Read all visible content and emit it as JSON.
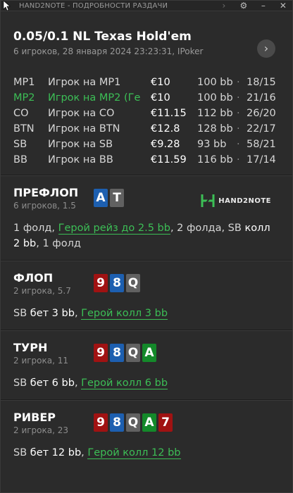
{
  "window": {
    "title": "HAND2NOTE - ПОДРОБНОСТИ РАЗДАЧИ",
    "icons": [
      "chevron-right-icon",
      "gear-icon",
      "minimize-icon",
      "close-icon"
    ]
  },
  "header": {
    "title": "0.05/0.1 NL Texas Hold'em",
    "subtitle": "6 игроков, 28 января 2024 23:23:31, IPoker",
    "nav_symbol": "›"
  },
  "players": [
    {
      "pos": "MP1",
      "name": "Игрок на MP1",
      "stack": "€10",
      "bb": "100 bb",
      "stats": "18/15",
      "hero": false
    },
    {
      "pos": "MP2",
      "name": "Игрок на MP2 (Ге",
      "stack": "€10",
      "bb": "100 bb",
      "stats": "21/16",
      "hero": true
    },
    {
      "pos": "CO",
      "name": "Игрок на CO",
      "stack": "€11.15",
      "bb": "112 bb",
      "stats": "26/20",
      "hero": false
    },
    {
      "pos": "BTN",
      "name": "Игрок на BTN",
      "stack": "€12.8",
      "bb": "128 bb",
      "stats": "22/17",
      "hero": false
    },
    {
      "pos": "SB",
      "name": "Игрок на SB",
      "stack": "€9.28",
      "bb": "93 bb",
      "stats": "58/21",
      "hero": false
    },
    {
      "pos": "BB",
      "name": "Игрок на BB",
      "stack": "€11.59",
      "bb": "116 bb",
      "stats": "17/14",
      "hero": false
    }
  ],
  "separator": "·",
  "brand": {
    "text": "HAND2NOTE",
    "color": "#3cbf56"
  },
  "streets": {
    "preflop": {
      "name": "ПРЕФЛОП",
      "sub": "6 игроков, 1.5",
      "cards": [
        {
          "rank": "A",
          "color": "#1d5fb0"
        },
        {
          "rank": "T",
          "color": "#616161"
        }
      ],
      "a1": "1 фолд, ",
      "a2": "Герой рейз до 2.5 bb",
      "a3": ", 2 фолда, SB ",
      "a4": "колл 2 bb",
      "a5": ", 1 фолд"
    },
    "flop": {
      "name": "ФЛОП",
      "sub": "2 игрока, 5.7",
      "cards": [
        {
          "rank": "9",
          "color": "#a01212"
        },
        {
          "rank": "8",
          "color": "#1d5fb0"
        },
        {
          "rank": "Q",
          "color": "#616161"
        }
      ],
      "a1": "SB ",
      "a2": "бет 3 bb",
      "a3": ", ",
      "a4": "Герой колл 3 bb"
    },
    "turn": {
      "name": "ТУРН",
      "sub": "2 игрока, 11",
      "cards": [
        {
          "rank": "9",
          "color": "#a01212"
        },
        {
          "rank": "8",
          "color": "#1d5fb0"
        },
        {
          "rank": "Q",
          "color": "#616161"
        },
        {
          "rank": "A",
          "color": "#14892a"
        }
      ],
      "a1": "SB ",
      "a2": "бет 6 bb",
      "a3": ", ",
      "a4": "Герой колл 6 bb"
    },
    "river": {
      "name": "РИВЕР",
      "sub": "2 игрока, 23",
      "cards": [
        {
          "rank": "9",
          "color": "#a01212"
        },
        {
          "rank": "8",
          "color": "#1d5fb0"
        },
        {
          "rank": "Q",
          "color": "#616161"
        },
        {
          "rank": "A",
          "color": "#14892a"
        },
        {
          "rank": "7",
          "color": "#a01212"
        }
      ],
      "a1": "SB ",
      "a2": "бет 12 bb",
      "a3": ", ",
      "a4": "Герой колл 12 bb"
    }
  }
}
